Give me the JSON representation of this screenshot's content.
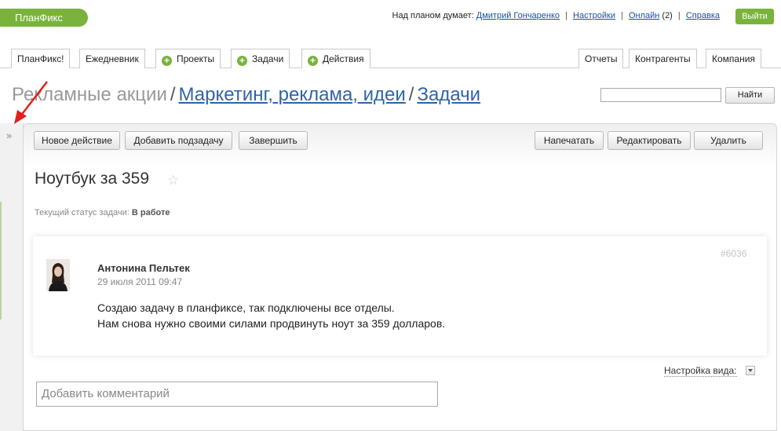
{
  "header": {
    "logo": "ПланФикс",
    "thinking_prefix": "Над планом думает:",
    "user": "Дмитрий Гончаренко",
    "sep": "|",
    "settings": "Настройки",
    "online": "Онлайн",
    "online_count": "(2)",
    "help": "Справка",
    "exit": "Выйти"
  },
  "tabs": {
    "planfix": "ПланФикс!",
    "diary": "Ежедневник",
    "projects": "Проекты",
    "tasks": "Задачи",
    "actions": "Действия",
    "reports": "Отчеты",
    "contractors": "Контрагенты",
    "company": "Компания",
    "plus": "+"
  },
  "breadcrumb": {
    "root": "Рекламные акции",
    "sep": "/",
    "project": "Маркетинг, реклама, идеи",
    "section": "Задачи"
  },
  "search": {
    "value": "",
    "button": "Найти"
  },
  "sidebar": {
    "expand": "»"
  },
  "toolbar": {
    "new_action": "Новое действие",
    "add_subtask": "Добавить подзадачу",
    "finish": "Завершить",
    "print": "Напечатать",
    "edit": "Редактировать",
    "delete": "Удалить"
  },
  "task": {
    "title": "Ноутбук за 359",
    "star": "☆",
    "status_label": "Текущий статус задачи:",
    "status_value": "В работе"
  },
  "comment": {
    "id": "#6036",
    "author": "Антонина Пельтек",
    "date": "29 июля 2011 09:47",
    "line1": "Создаю задачу в планфиксе, так подключены все отделы.",
    "line2": "Нам снова нужно своими силами продвинуть ноут за 359 долларов."
  },
  "view": {
    "settings": "Настройка вида:"
  },
  "add_comment": {
    "placeholder": "Добавить комментарий"
  },
  "colors": {
    "accent": "#7ab33c",
    "link": "#2f64a8",
    "annotation_arrow": "#e02020"
  }
}
